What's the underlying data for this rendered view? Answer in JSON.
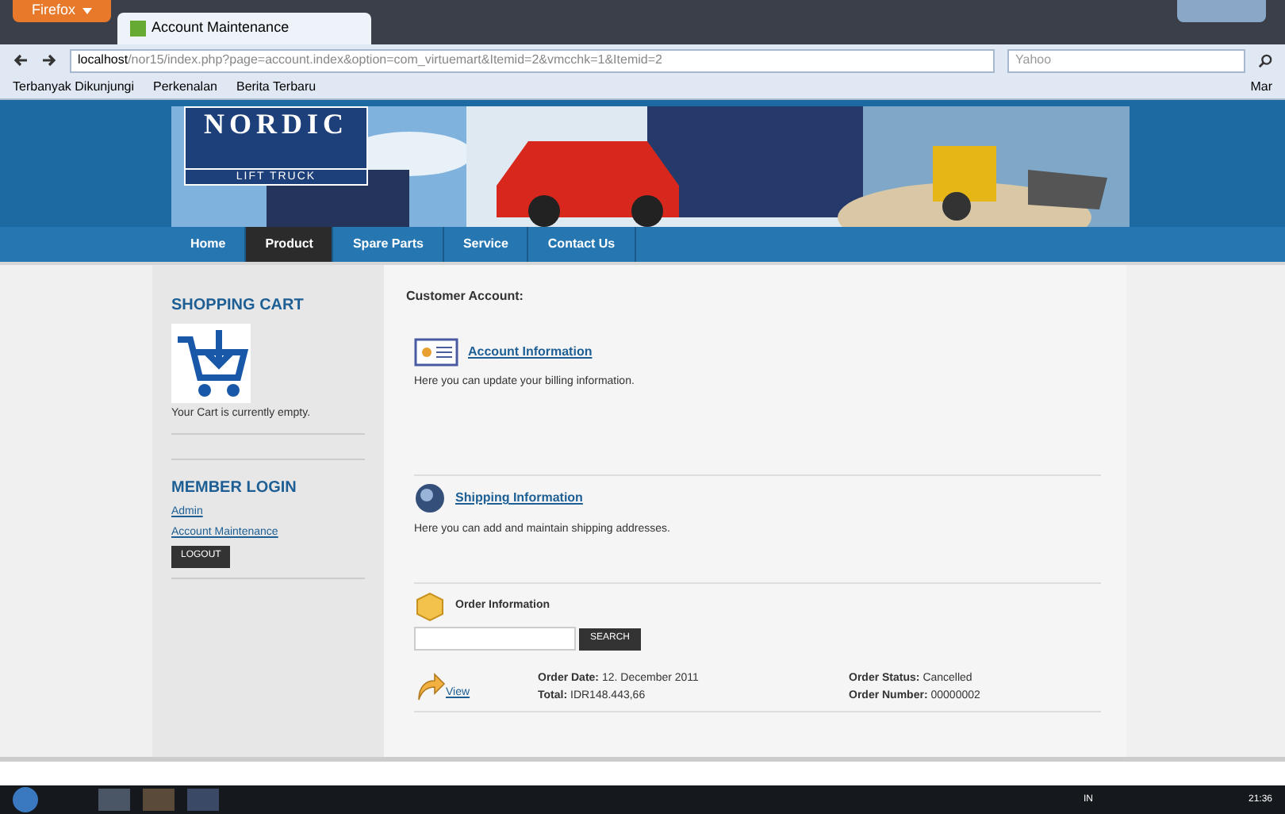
{
  "browser": {
    "menu_button": "Firefox",
    "tab_title": "Account Maintenance",
    "url_host": "localhost",
    "url_path": "/nor15/index.php?page=account.index&option=com_virtuemart&Itemid=2&vmcchk=1&Itemid=2",
    "search_placeholder": "Yahoo",
    "bookmarks": [
      "Terbanyak Dikunjungi",
      "Perkenalan",
      "Berita Terbaru"
    ],
    "bookmarks_right": "Mar"
  },
  "site": {
    "logo_title": "NORDIC",
    "logo_subtitle": "LIFT TRUCK",
    "nav": [
      {
        "label": "Home",
        "selected": false
      },
      {
        "label": "Product",
        "selected": true
      },
      {
        "label": "Spare Parts",
        "selected": false
      },
      {
        "label": "Service",
        "selected": false
      },
      {
        "label": "Contact Us",
        "selected": false
      }
    ]
  },
  "sidebar": {
    "cart_title": "SHOPPING CART",
    "cart_text": "Your Cart is currently empty.",
    "login_title": "MEMBER LOGIN",
    "links": [
      "Admin",
      "Account Maintenance"
    ],
    "logout": "LOGOUT"
  },
  "main": {
    "heading": "Customer Account:",
    "sections": [
      {
        "kind": "card",
        "link": "Account Information",
        "text": "Here you can update your billing information."
      },
      {
        "kind": "globe",
        "link": "Shipping Information",
        "text": "Here you can add and maintain shipping addresses."
      }
    ],
    "orders": {
      "title": "Order Information",
      "search_button": "SEARCH",
      "rows": [
        {
          "view": "View",
          "date_label": "Order Date:",
          "date": "12. December 2011",
          "total_label": "Total:",
          "total": "IDR148.443,66",
          "status_label": "Order Status:",
          "status": "Cancelled",
          "number_label": "Order Number:",
          "number": "00000002"
        }
      ]
    }
  },
  "taskbar": {
    "language": "IN",
    "clock": "21:36"
  }
}
